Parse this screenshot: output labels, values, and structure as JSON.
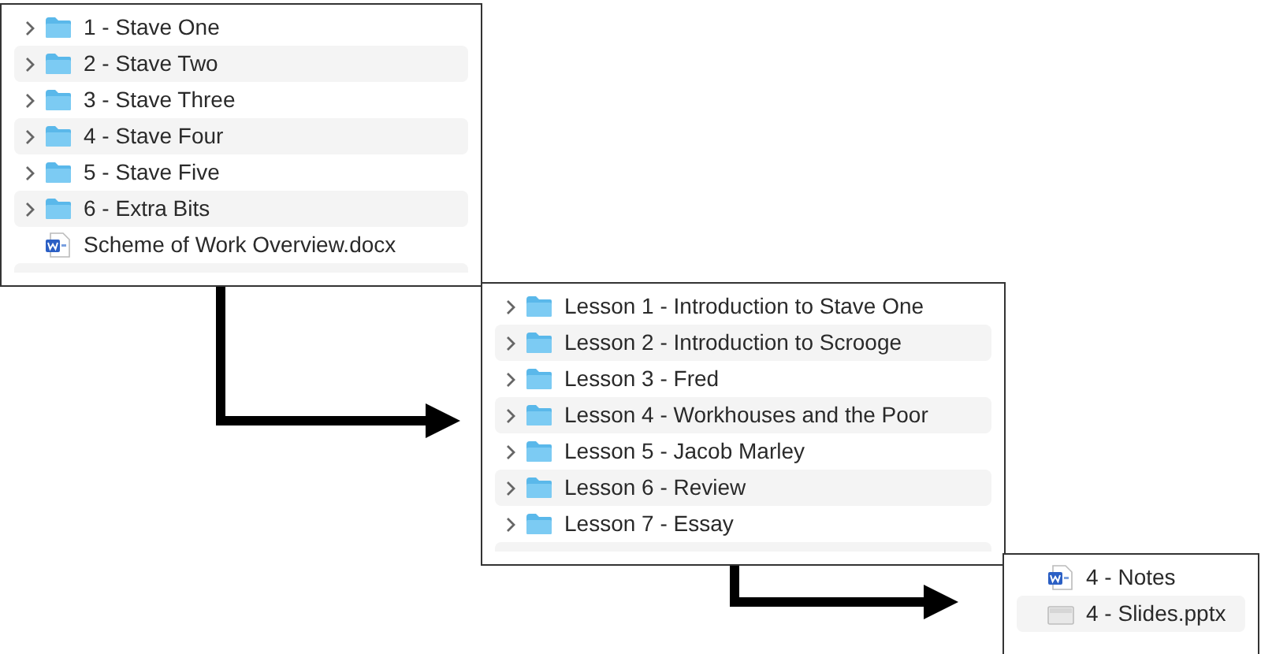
{
  "panels": [
    {
      "items": [
        {
          "kind": "folder",
          "name": "1 - Stave One"
        },
        {
          "kind": "folder",
          "name": "2 - Stave Two"
        },
        {
          "kind": "folder",
          "name": "3 - Stave Three"
        },
        {
          "kind": "folder",
          "name": "4 - Stave Four"
        },
        {
          "kind": "folder",
          "name": "5 - Stave Five"
        },
        {
          "kind": "folder",
          "name": "6 - Extra Bits"
        },
        {
          "kind": "word",
          "name": "Scheme of Work Overview.docx"
        }
      ]
    },
    {
      "items": [
        {
          "kind": "folder",
          "name": "Lesson 1 - Introduction to Stave One"
        },
        {
          "kind": "folder",
          "name": "Lesson 2 - Introduction to Scrooge"
        },
        {
          "kind": "folder",
          "name": "Lesson 3 - Fred"
        },
        {
          "kind": "folder",
          "name": "Lesson 4 - Workhouses and the Poor"
        },
        {
          "kind": "folder",
          "name": "Lesson 5 - Jacob Marley"
        },
        {
          "kind": "folder",
          "name": "Lesson 6 - Review"
        },
        {
          "kind": "folder",
          "name": "Lesson 7 - Essay"
        }
      ]
    },
    {
      "items": [
        {
          "kind": "word",
          "name": "4 - Notes"
        },
        {
          "kind": "slides",
          "name": "4 - Slides.pptx"
        }
      ]
    }
  ]
}
